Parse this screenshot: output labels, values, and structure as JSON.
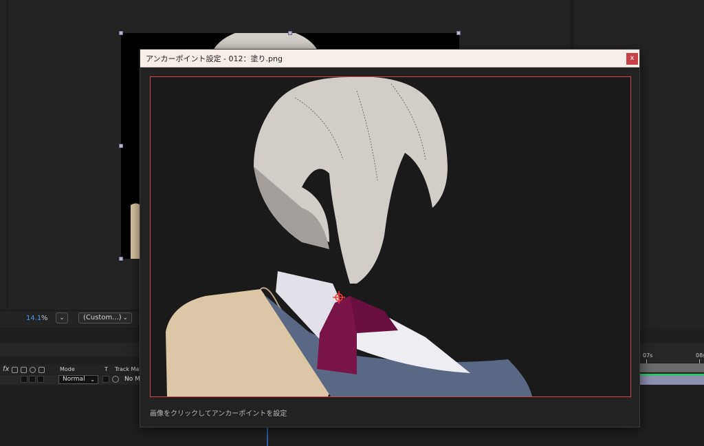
{
  "viewer": {
    "zoom_value": "14.1",
    "zoom_unit": "%",
    "zoom_dropdown_glyph": "⌄",
    "resolution": "(Custom...)",
    "resolution_glyph": "⌄"
  },
  "timeline": {
    "fx_label": "fx",
    "columns": {
      "mode": "Mode",
      "t": "T",
      "track_matte": "Track Matt"
    },
    "layer": {
      "mode": "Normal",
      "mode_glyph": "⌄",
      "track_matte": "No M"
    },
    "ruler_labels": [
      "07s",
      "08s"
    ]
  },
  "dialog": {
    "title": "アンカーポイント設定 - 012：塗り.png",
    "close_label": "x",
    "hint": "画像をクリックしてアンカーポイントを設定"
  },
  "colors": {
    "accent_blue": "#4a9cf0",
    "dialog_border": "#d0474a",
    "close_button": "#c8414a",
    "anchor_marker": "#ff3a3a"
  }
}
